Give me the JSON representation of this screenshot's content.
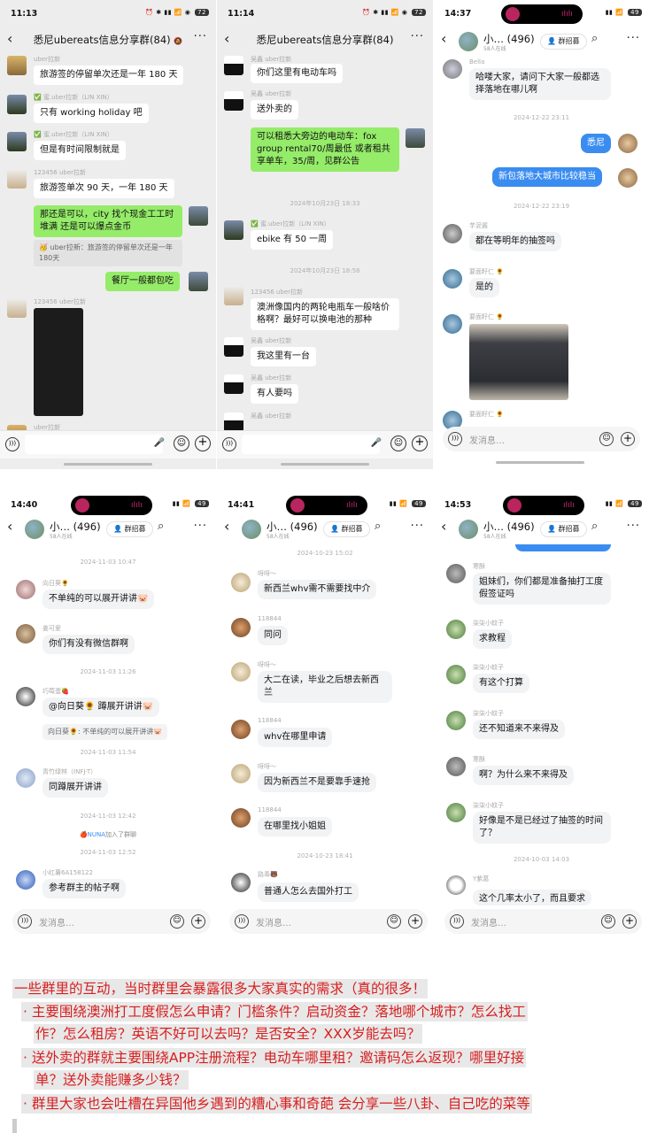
{
  "accent_colors": {
    "wechat_bubble": "#95ec69",
    "qq_bubble": "#3a8cf0",
    "note_red": "#d81e1e"
  },
  "p1": {
    "status": {
      "time": "11:13",
      "bat": "72"
    },
    "title": "悉尼ubereats信息分享群(84)",
    "msgs": [
      {
        "nick": "uber拉新",
        "text": "旅游签的停留单次还是一年 180 天"
      },
      {
        "nick": "✅ 蜜.uber拉新（LIN XIN）",
        "text": "只有 working holiday 吧"
      },
      {
        "nick": "✅ 蜜.uber拉新（LIN XIN）",
        "text": "但是有时间限制就是"
      },
      {
        "nick": "123456 uber拉新",
        "text": "旅游签单次 90 天，一年 180 天"
      },
      {
        "text": "那还是可以，city 找个现金工工时堆满 还是可以爆点金币"
      },
      {
        "text": "🥳 uber拉新：旅游签的停留单次还是一年180天"
      },
      {
        "text": "餐厅一般都包吃"
      },
      {
        "nick": "123456 uber拉新"
      },
      {
        "nick": "uber拉新"
      }
    ]
  },
  "p2": {
    "status": {
      "time": "11:14",
      "bat": "72"
    },
    "title": "悉尼ubereats信息分享群(84)",
    "msgs": [
      {
        "nick": "吴鑫 uber拉新",
        "text": "你们这里有电动车吗"
      },
      {
        "nick": "吴鑫 uber拉新",
        "text": "送外卖的"
      },
      {
        "text": "可以租悉大旁边的电动车：fox group rental70/周最低 或者租共享单车，35/周，见群公告"
      },
      {
        "ts": "2024年10月23日 18:33"
      },
      {
        "nick": "✅ 蜜.uber拉新（LIN XIN）",
        "text": "ebike 有 50 一周"
      },
      {
        "ts": "2024年10月23日 18:58"
      },
      {
        "nick": "123456 uber拉新",
        "text": "澳洲像国内的两轮电瓶车一般啥价格啊？最好可以换电池的那种"
      },
      {
        "nick": "吴鑫 uber拉新",
        "text": "我这里有一台"
      },
      {
        "nick": "吴鑫 uber拉新",
        "text": "有人要吗"
      },
      {
        "nick": "吴鑫 uber拉新"
      }
    ]
  },
  "p3": {
    "status": {
      "time": "14:37",
      "bat": "49"
    },
    "name": "小…",
    "count": "(496)",
    "online": "58人在线",
    "recruit": "群招募",
    "msgs": [
      {
        "nick": "Bella",
        "text": "哈喽大家，请问下大家一般都选择落地在哪儿啊"
      },
      {
        "ts": "2024-12-22 23:11"
      },
      {
        "text": "悉尼"
      },
      {
        "text": "新包落地大城市比较稳当"
      },
      {
        "ts": "2024-12-22 23:19"
      },
      {
        "nick": "芋泥酱",
        "text": "都在等明年的抽签吗"
      },
      {
        "nick": "要面籽仁 🌻",
        "text": "是的"
      },
      {
        "nick": "要面籽仁 🌻"
      },
      {
        "nick": "要面籽仁 🌻"
      }
    ],
    "input": "发消息…"
  },
  "p4": {
    "status": {
      "time": "14:40",
      "bat": "49"
    },
    "name": "小…",
    "count": "(496)",
    "online": "58人在线",
    "recruit": "群招募",
    "msgs": [
      {
        "ts": "2024-11-03 10:47"
      },
      {
        "nick": "向日葵🌻",
        "text": "不单纯的可以展开讲讲🐷"
      },
      {
        "nick": "姜可爱",
        "text": "你们有没有微信群啊"
      },
      {
        "ts": "2024-11-03 11:26"
      },
      {
        "nick": "巧莓蛋🍓",
        "text": "@向日葵🌻  蹲展开讲讲🐷"
      },
      {
        "text": "向日葵🌻: 不单纯的可以展开讲讲🐷"
      },
      {
        "ts": "2024-11-03 11:54"
      },
      {
        "nick": "青竹绿林（INFJ-T）",
        "text": "同蹲展开讲讲"
      },
      {
        "ts": "2024-11-03 12:42"
      },
      {
        "join_name": "🍎NUNA",
        "join_text": "加入了群聊"
      },
      {
        "ts": "2024-11-03 12:52"
      },
      {
        "nick": "小红薯6A158122",
        "text": "参考群主的帖子啊"
      }
    ],
    "input": "发消息…"
  },
  "p5": {
    "status": {
      "time": "14:41",
      "bat": "49"
    },
    "name": "小…",
    "count": "(496)",
    "online": "58人在线",
    "recruit": "群招募",
    "msgs": [
      {
        "ts": "2024-10-23 15:02"
      },
      {
        "nick": "呀呀～",
        "text": "新西兰whv需不需要找中介"
      },
      {
        "nick": "118844",
        "text": "同问"
      },
      {
        "nick": "呀呀～",
        "text": "大二在读，毕业之后想去新西兰"
      },
      {
        "nick": "118844",
        "text": "whv在哪里申请"
      },
      {
        "nick": "呀呀～",
        "text": "因为新西兰不是要靠手速抢"
      },
      {
        "nick": "118844",
        "text": "在哪里找小姐姐"
      },
      {
        "ts": "2024-10-23 18:41"
      },
      {
        "nick": "路毒🐻",
        "text": "普通人怎么去国外打工"
      }
    ],
    "input": "发消息…"
  },
  "p6": {
    "status": {
      "time": "14:53",
      "bat": "49"
    },
    "name": "小…",
    "count": "(496)",
    "online": "58人在线",
    "recruit": "群招募",
    "msgs": [
      {
        "nick": "寒酥",
        "text": "姐妹们，你们都是准备抽打工度假签证吗"
      },
      {
        "nick": "柒柒小蚊子",
        "text": "求教程"
      },
      {
        "nick": "柒柒小蚊子",
        "text": "有这个打算"
      },
      {
        "nick": "柒柒小蚊子",
        "text": "还不知道来不来得及"
      },
      {
        "nick": "寒酥",
        "text": "啊？为什么来不来得及"
      },
      {
        "nick": "柒柒小蚊子",
        "text": "好像是不是已经过了抽签的时间了？"
      },
      {
        "ts": "2024-10-03 14:03"
      },
      {
        "nick": "Y紫葛",
        "text": "这个几率太小了，而且要求"
      }
    ],
    "input": "发消息…"
  },
  "notes": {
    "headline": "一些群里的互动，当时群里会暴露很多大家真实的需求（真的很多！",
    "b1a": "· 主要围绕澳洲打工度假怎么申请？门槛条件？启动资金？落地哪个城市？怎么找工",
    "b1b": "作？怎么租房？英语不好可以去吗？是否安全？XXX岁能去吗？",
    "b2a": "· 送外卖的群就主要围绕APP注册流程？电动车哪里租？邀请码怎么返现？哪里好接",
    "b2b": "单？送外卖能赚多少钱？",
    "b3": "· 群里大家也会吐槽在异国他乡遇到的糟心事和奇葩 会分享一些八卦、自己吃的菜等"
  }
}
